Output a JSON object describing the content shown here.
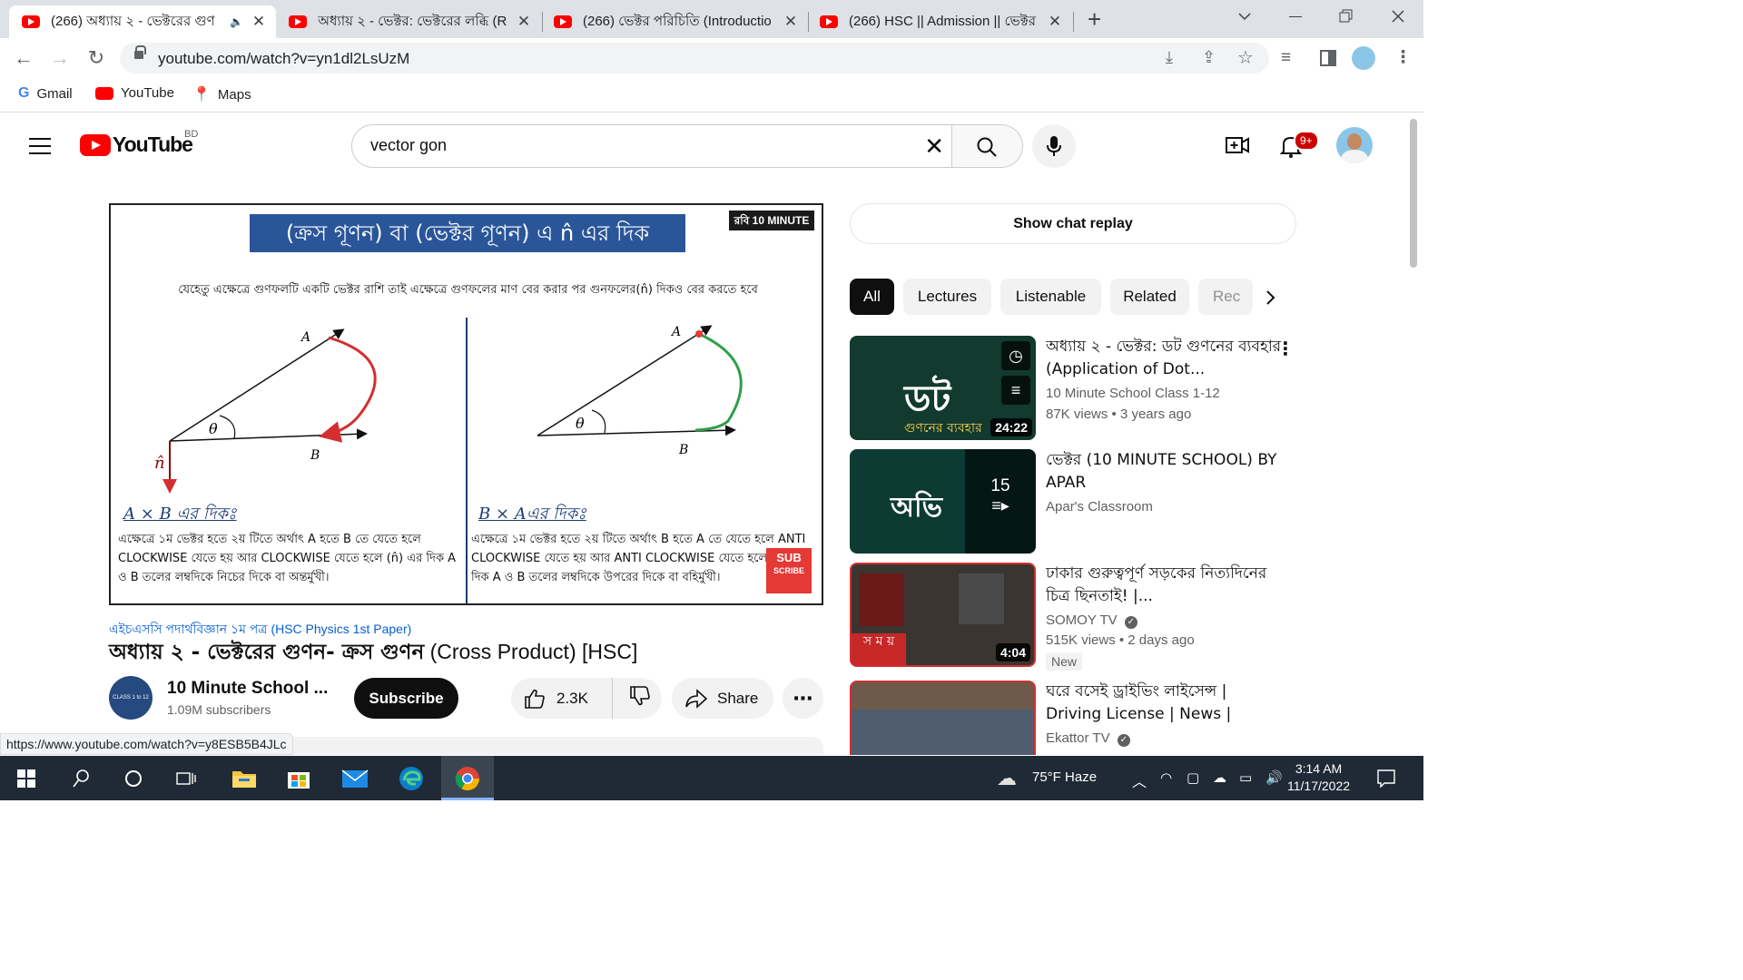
{
  "tabs": [
    {
      "title": "(266) অধ্যায় ২ - ভেক্টরের গুণ",
      "active": true
    },
    {
      "title": "অধ্যায় ২ - ভেক্টর: ভেক্টরের লব্ধি (R",
      "active": false
    },
    {
      "title": "(266) ভেক্টর পরিচিতি (Introductio",
      "active": false
    },
    {
      "title": "(266) HSC || Admission || ভেক্টর",
      "active": false
    }
  ],
  "address": {
    "url": "youtube.com/watch?v=yn1dl2LsUzM"
  },
  "bookmarks": [
    {
      "label": "Gmail"
    },
    {
      "label": "YouTube"
    },
    {
      "label": "Maps"
    }
  ],
  "youtube": {
    "country_code": "BD",
    "logo_text": "YouTube",
    "search_value": "vector gon",
    "notification_count": "9+"
  },
  "video_frame": {
    "heading": "(ক্রস গূণন) বা (ভেক্টর গূণন) এ n̂ এর দিক",
    "brand": "রবি 10 MINUTE SCHOOL",
    "subtitle": "যেহেতু এক্ষেত্রে গুণফলটি একটি ভেক্টর রাশি তাই এক্ষেত্রে গুণফলের মাণ বের করার পর গুনফলের(n̂) দিকও বের করতে হবে",
    "left_heading": "A × B এর  দিকঃ",
    "left_text": "এক্ষেত্রে ১ম ভেক্টর হতে ২য় টিতে অর্থাৎ  A হতে B তে যেতে হলে CLOCKWISE যেতে হয় আর CLOCKWISE  যেতে হলে (n̂) এর দিক A ও B তলের লম্বদিকে নিচের দিকে বা অন্তর্মুখী।",
    "right_heading": "B × Aএর  দিকঃ",
    "right_text": "এক্ষেত্রে ১ম ভেক্টর হতে ২য় টিতে অর্থাৎ  B হতে A  তে যেতে হলে ANTI CLOCKWISE যেতে হয় আর ANTI CLOCKWISE যেতে হলে (n̂)  এর দিক A ও B তলের লম্বদিকে উপরের দিকে বা বহির্মুখী।",
    "label_A": "A",
    "label_B": "B",
    "label_theta": "θ",
    "label_n": "n̂",
    "sub_badge_1": "SUB",
    "sub_badge_2": "SCRIBE"
  },
  "video_meta": {
    "playlist": "এইচএসসি পদার্থবিজ্ঞান ১ম পত্র (HSC Physics 1st Paper)",
    "title_bn": "অধ্যায় ২ - ভেক্টরের গুণন- ক্রস গুণন",
    "title_en": " (Cross Product) [HSC]",
    "channel": "10 Minute School ...",
    "subscribers": "1.09M subscribers",
    "subscribe_label": "Subscribe",
    "likes": "2.3K",
    "share_label": "Share"
  },
  "sidebar": {
    "chat_replay": "Show chat replay",
    "chips": [
      "All",
      "Lectures",
      "Listenable",
      "Related",
      "Rec"
    ],
    "recommendations": [
      {
        "title": "অধ্যায় ২ - ভেক্টর: ডট গুণনের ব্যবহার (Application of Dot...",
        "channel": "10 Minute School Class 1-12",
        "meta": "87K views  • 3 years ago",
        "duration": "24:22"
      },
      {
        "title": "ভেক্টর (10 MINUTE SCHOOL) BY APAR",
        "channel": "Apar's Classroom",
        "meta": "",
        "duration": "15"
      },
      {
        "title": "ঢাকার গুরুত্বপূর্ণ সড়কের নিত্যদিনের চিত্র ছিনতাই! |...",
        "channel": "SOMOY TV",
        "meta": "515K views  • 2 days ago",
        "duration": "4:04",
        "badge": "New"
      },
      {
        "title": "ঘরে বসেই ড্রাইভিং লাইসেন্স | Driving License | News | Ekatto...",
        "channel": "Ekattor TV",
        "meta": "",
        "duration": ""
      }
    ]
  },
  "status_url": "https://www.youtube.com/watch?v=y8ESB5B4JLc",
  "taskbar": {
    "weather": "75°F  Haze",
    "time": "3:14 AM",
    "date": "11/17/2022"
  },
  "colors": {
    "accent": "#ff0000",
    "link": "#065fd4",
    "video_title_bg": "#2a5699"
  }
}
